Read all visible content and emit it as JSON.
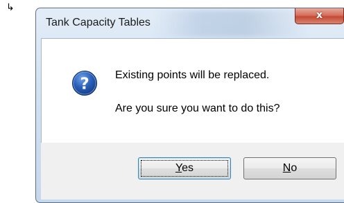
{
  "window": {
    "title": "Tank Capacity Tables",
    "close_glyph": "x"
  },
  "message": {
    "line1": "Existing points will be replaced.",
    "line2": "Are you sure you want to do this?",
    "icon": "question-icon"
  },
  "buttons": {
    "yes_label_accel": "Y",
    "yes_label_rest": "es",
    "no_label_accel": "N",
    "no_label_rest": "o",
    "default": "yes"
  },
  "colors": {
    "icon_blue": "#2a5fb8",
    "close_red": "#c44a36",
    "focus_border": "#3c7fb1"
  }
}
